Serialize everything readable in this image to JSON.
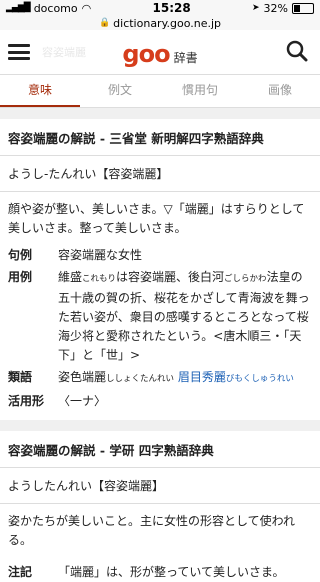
{
  "status": {
    "carrier": "docomo",
    "time": "15:28",
    "battery": "32%",
    "battery_level": 0.32
  },
  "browser": {
    "url": "dictionary.goo.ne.jp"
  },
  "header": {
    "ghost_text": "容姿端麗",
    "logo": "goo",
    "logo_sub": "辞書"
  },
  "tabs": [
    "意味",
    "例文",
    "慣用句",
    "画像"
  ],
  "entry1": {
    "title": "容姿端麗の解説 - 三省堂 新明解四字熟語辞典",
    "reading": "ようし-たんれい【容姿端麗】",
    "definition": "顔や姿が整い、美しいさま。▽「端麗」はすらりとして美しいさま。整って美しいさま。",
    "rows": [
      {
        "key": "句例",
        "value": "容姿端麗な女性"
      },
      {
        "key": "用例",
        "value_parts": [
          "維盛",
          "これもり",
          "は容姿端麗、後白河",
          "ごしらかわ",
          "法皇の五十歳の賀の折、桜花をかざして青海波を舞った若い姿が、衆目の感嘆するところとなって桜海少将と愛称されたという。<唐木順三・「天下」と「世」>"
        ]
      },
      {
        "key": "類語",
        "value_parts": [
          "姿色端麗",
          "ししょくたんれい",
          "眉目秀麗",
          "びもくしゅうれい"
        ]
      },
      {
        "key": "活用形",
        "value": "〈一ナ〉"
      }
    ]
  },
  "entry2": {
    "title": "容姿端麗の解説 - 学研 四字熟語辞典",
    "reading": "ようしたんれい【容姿端麗】",
    "definition": "姿かたちが美しいこと。主に女性の形容として使われる。",
    "rows": [
      {
        "key": "注記",
        "value": "「端麗」は、形が整っていて美しいさま。"
      }
    ]
  }
}
